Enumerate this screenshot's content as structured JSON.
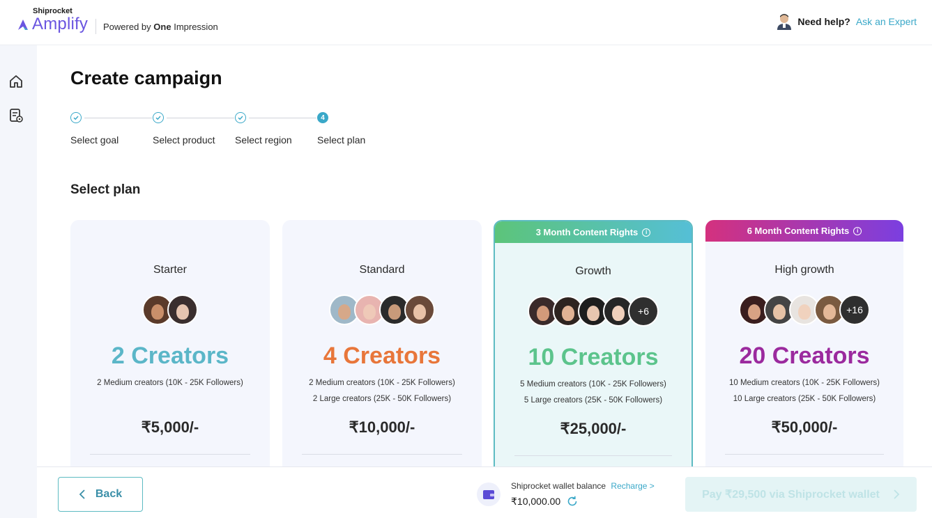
{
  "header": {
    "brand_small": "Shiprocket",
    "brand_name": "Amplify",
    "powered_prefix": "Powered by",
    "powered_bold": "One",
    "powered_suffix": "Impression",
    "help_question": "Need help?",
    "help_link": "Ask an Expert"
  },
  "sidebar": {
    "items": [
      {
        "icon": "home-icon"
      },
      {
        "icon": "campaign-document-icon"
      }
    ]
  },
  "page": {
    "title": "Create campaign",
    "section_title": "Select plan"
  },
  "stepper": {
    "steps": [
      {
        "label": "Select goal",
        "status": "complete"
      },
      {
        "label": "Select product",
        "status": "complete"
      },
      {
        "label": "Select region",
        "status": "complete"
      },
      {
        "label": "Select plan",
        "status": "active",
        "number": "4"
      }
    ]
  },
  "plans": [
    {
      "name": "Starter",
      "banner": "",
      "count_label": "2 Creators",
      "details": [
        "2 Medium creators (10K - 25K Followers)"
      ],
      "price": "₹5,000/-",
      "accent": "#5bb6c8",
      "avatars": 2,
      "more": ""
    },
    {
      "name": "Standard",
      "banner": "",
      "count_label": "4 Creators",
      "details": [
        "2 Medium creators (10K - 25K Followers)",
        "2 Large creators (25K - 50K Followers)"
      ],
      "price": "₹10,000/-",
      "accent": "#e8763a",
      "avatars": 4,
      "more": ""
    },
    {
      "name": "Growth",
      "banner": "3 Month Content Rights",
      "count_label": "10 Creators",
      "details": [
        "5 Medium creators (10K - 25K Followers)",
        "5 Large creators (25K - 50K Followers)"
      ],
      "price": "₹25,000/-",
      "accent": "#5cc48c",
      "avatars": 4,
      "more": "+6"
    },
    {
      "name": "High growth",
      "banner": "6 Month Content Rights",
      "count_label": "20 Creators",
      "details": [
        "10 Medium creators (10K - 25K Followers)",
        "10 Large creators (25K - 50K Followers)"
      ],
      "price": "₹50,000/-",
      "accent": "#9b2a9e",
      "avatars": 4,
      "more": "+16"
    }
  ],
  "footer": {
    "back_label": "Back",
    "wallet_label": "Shiprocket wallet balance",
    "recharge_label": "Recharge >",
    "wallet_amount": "₹10,000.00",
    "pay_label": "Pay ₹29,500 via Shiprocket wallet"
  },
  "colors": {
    "brand": "#6a55e0",
    "teal": "#3aa8c8",
    "growth_banner_from": "#5cc47a",
    "growth_banner_to": "#55bfd6",
    "highgrowth_banner_from": "#d4317e",
    "highgrowth_banner_to": "#7b3fe0"
  }
}
